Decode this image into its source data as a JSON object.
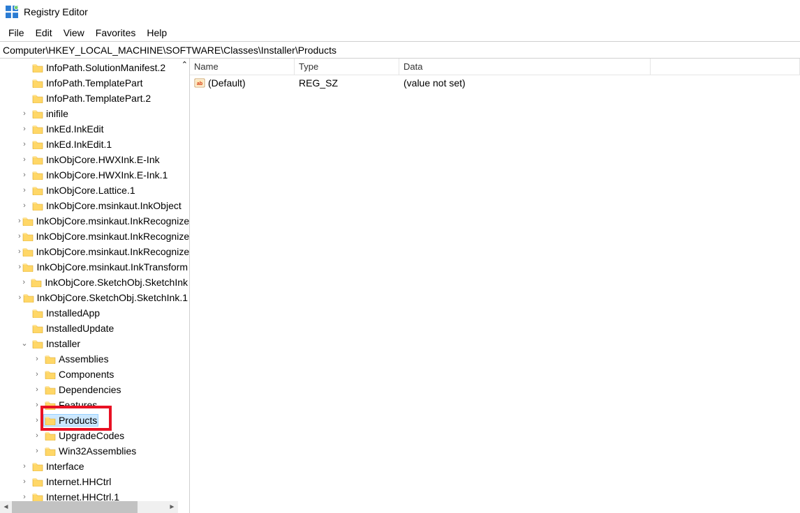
{
  "app": {
    "title": "Registry Editor"
  },
  "menu": {
    "items": [
      "File",
      "Edit",
      "View",
      "Favorites",
      "Help"
    ]
  },
  "address": "Computer\\HKEY_LOCAL_MACHINE\\SOFTWARE\\Classes\\Installer\\Products",
  "tree": [
    {
      "indent": 1,
      "expander": "blank",
      "label": "InfoPath.SolutionManifest.2"
    },
    {
      "indent": 1,
      "expander": "blank",
      "label": "InfoPath.TemplatePart"
    },
    {
      "indent": 1,
      "expander": "blank",
      "label": "InfoPath.TemplatePart.2"
    },
    {
      "indent": 1,
      "expander": "collapsed",
      "label": "inifile"
    },
    {
      "indent": 1,
      "expander": "collapsed",
      "label": "InkEd.InkEdit"
    },
    {
      "indent": 1,
      "expander": "collapsed",
      "label": "InkEd.InkEdit.1"
    },
    {
      "indent": 1,
      "expander": "collapsed",
      "label": "InkObjCore.HWXInk.E-Ink"
    },
    {
      "indent": 1,
      "expander": "collapsed",
      "label": "InkObjCore.HWXInk.E-Ink.1"
    },
    {
      "indent": 1,
      "expander": "collapsed",
      "label": "InkObjCore.Lattice.1"
    },
    {
      "indent": 1,
      "expander": "collapsed",
      "label": "InkObjCore.msinkaut.InkObject"
    },
    {
      "indent": 1,
      "expander": "collapsed",
      "label": "InkObjCore.msinkaut.InkRecognizer"
    },
    {
      "indent": 1,
      "expander": "collapsed",
      "label": "InkObjCore.msinkaut.InkRecognizerContext"
    },
    {
      "indent": 1,
      "expander": "collapsed",
      "label": "InkObjCore.msinkaut.InkRecognizerGuide"
    },
    {
      "indent": 1,
      "expander": "collapsed",
      "label": "InkObjCore.msinkaut.InkTransform"
    },
    {
      "indent": 1,
      "expander": "collapsed",
      "label": "InkObjCore.SketchObj.SketchInk"
    },
    {
      "indent": 1,
      "expander": "collapsed",
      "label": "InkObjCore.SketchObj.SketchInk.1"
    },
    {
      "indent": 1,
      "expander": "blank",
      "label": "InstalledApp"
    },
    {
      "indent": 1,
      "expander": "blank",
      "label": "InstalledUpdate"
    },
    {
      "indent": 1,
      "expander": "expanded",
      "label": "Installer"
    },
    {
      "indent": 2,
      "expander": "collapsed",
      "label": "Assemblies"
    },
    {
      "indent": 2,
      "expander": "collapsed",
      "label": "Components"
    },
    {
      "indent": 2,
      "expander": "collapsed",
      "label": "Dependencies"
    },
    {
      "indent": 2,
      "expander": "collapsed",
      "label": "Features"
    },
    {
      "indent": 2,
      "expander": "collapsed",
      "label": "Products",
      "selected": true,
      "highlighted": true
    },
    {
      "indent": 2,
      "expander": "collapsed",
      "label": "UpgradeCodes"
    },
    {
      "indent": 2,
      "expander": "collapsed",
      "label": "Win32Assemblies"
    },
    {
      "indent": 1,
      "expander": "collapsed",
      "label": "Interface"
    },
    {
      "indent": 1,
      "expander": "collapsed",
      "label": "Internet.HHCtrl"
    },
    {
      "indent": 1,
      "expander": "collapsed",
      "label": "Internet.HHCtrl.1"
    }
  ],
  "list": {
    "columns": {
      "name": "Name",
      "type": "Type",
      "data": "Data"
    },
    "rows": [
      {
        "name": "(Default)",
        "type": "REG_SZ",
        "data": "(value not set)"
      }
    ]
  }
}
